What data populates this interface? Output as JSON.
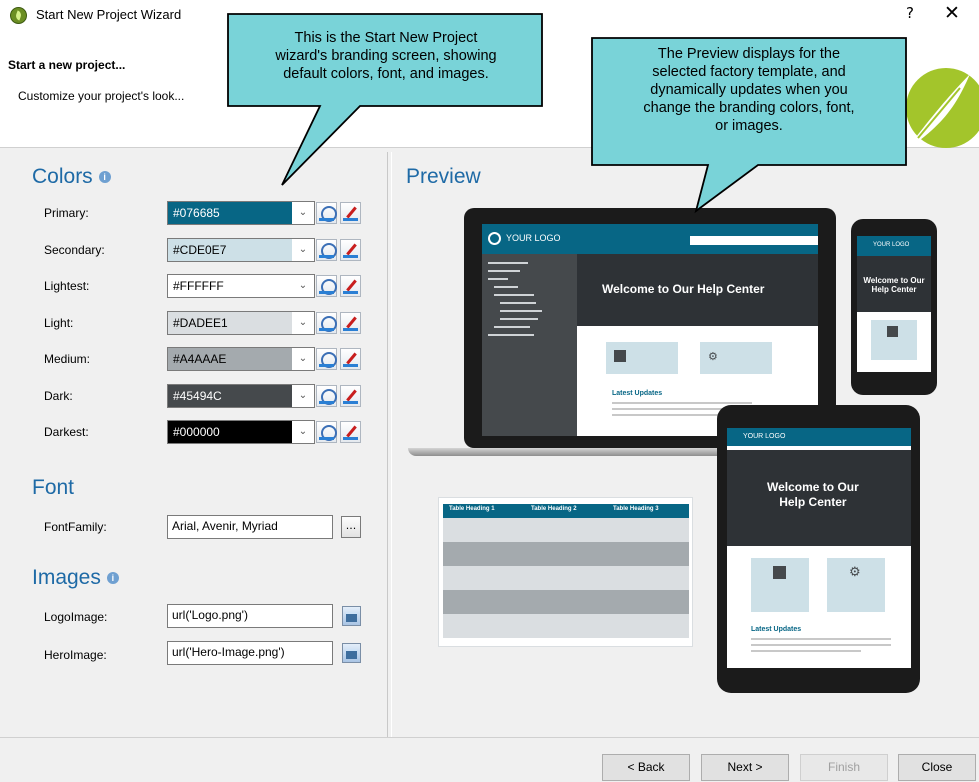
{
  "window": {
    "title": "Start New Project Wizard",
    "help_glyph": "?",
    "close_glyph": "✕"
  },
  "header": {
    "title": "Start a new project...",
    "subtitle": "Customize your project's look..."
  },
  "colors": {
    "heading": "Colors",
    "info_glyph": "i",
    "rows": [
      {
        "label": "Primary:",
        "value": "#076685",
        "fill": "#076685",
        "text_color": "#ffffff"
      },
      {
        "label": "Secondary:",
        "value": "#CDE0E7",
        "fill": "#CDE0E7",
        "text_color": "#000000"
      },
      {
        "label": "Lightest:",
        "value": "#FFFFFF",
        "fill": "#FFFFFF",
        "text_color": "#000000"
      },
      {
        "label": "Light:",
        "value": "#DADEE1",
        "fill": "#DADEE1",
        "text_color": "#000000"
      },
      {
        "label": "Medium:",
        "value": "#A4AAAE",
        "fill": "#A4AAAE",
        "text_color": "#000000"
      },
      {
        "label": "Dark:",
        "value": "#45494C",
        "fill": "#45494C",
        "text_color": "#ffffff"
      },
      {
        "label": "Darkest:",
        "value": "#000000",
        "fill": "#000000",
        "text_color": "#ffffff"
      }
    ]
  },
  "font": {
    "heading": "Font",
    "label": "FontFamily:",
    "value": "Arial, Avenir, Myriad",
    "browse_label": "..."
  },
  "images": {
    "heading": "Images",
    "info_glyph": "i",
    "logo": {
      "label": "LogoImage:",
      "value": "url('Logo.png')"
    },
    "hero": {
      "label": "HeroImage:",
      "value": "url('Hero-Image.png')"
    }
  },
  "preview": {
    "heading": "Preview",
    "logo_text": "YOUR LOGO",
    "hero_text": "Welcome to Our Help Center",
    "hero_line1": "Welcome to Our",
    "hero_line2": "Help Center",
    "updates_heading": "Latest Updates",
    "table_headings": [
      "Table Heading 1",
      "Table Heading 2",
      "Table Heading 3"
    ]
  },
  "callouts": {
    "left": [
      "This is the Start New Project",
      "wizard's branding screen, showing",
      "default colors, font, and images."
    ],
    "right": [
      "The Preview displays for the",
      "selected factory template, and",
      "dynamically updates when you",
      "change the branding colors, font,",
      "or images."
    ]
  },
  "footer": {
    "back": "< Back",
    "next": "Next >",
    "finish": "Finish",
    "close": "Close"
  },
  "theme": {
    "accent": "#1e6aa6",
    "callout_fill": "#79d3d8",
    "brand_green": "#9dc12a"
  }
}
